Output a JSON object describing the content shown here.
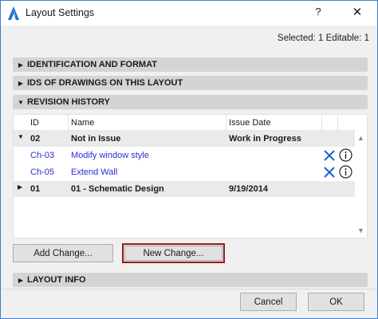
{
  "window": {
    "title": "Layout Settings",
    "help_label": "?",
    "close_label": "✕"
  },
  "status": {
    "selection_text": "Selected: 1 Editable: 1"
  },
  "sections": {
    "identification": "IDENTIFICATION AND FORMAT",
    "ids_of_drawings": "IDS OF DRAWINGS ON THIS LAYOUT",
    "revision_history": "REVISION HISTORY",
    "layout_info": "LAYOUT INFO"
  },
  "table": {
    "columns": {
      "id": "ID",
      "name": "Name",
      "issue_date": "Issue Date"
    },
    "rows": [
      {
        "kind": "group",
        "id": "02",
        "name": "Not in Issue",
        "issue_date": "Work in Progress",
        "expanded": true
      },
      {
        "kind": "item",
        "id": "Ch-03",
        "name": "Modify window style",
        "issue_date": ""
      },
      {
        "kind": "item",
        "id": "Ch-05",
        "name": "Extend Wall",
        "issue_date": ""
      },
      {
        "kind": "group",
        "id": "01",
        "name": "01 - Schematic Design",
        "issue_date": "9/19/2014",
        "expanded": false
      }
    ]
  },
  "buttons": {
    "add_change": "Add Change...",
    "new_change": "New Change...",
    "cancel": "Cancel",
    "ok": "OK"
  },
  "colors": {
    "accent_border": "#3a7bd5",
    "link_text": "#2b2bd6",
    "focus_outline": "#9b1b1b",
    "x_icon": "#1f5fd6"
  }
}
